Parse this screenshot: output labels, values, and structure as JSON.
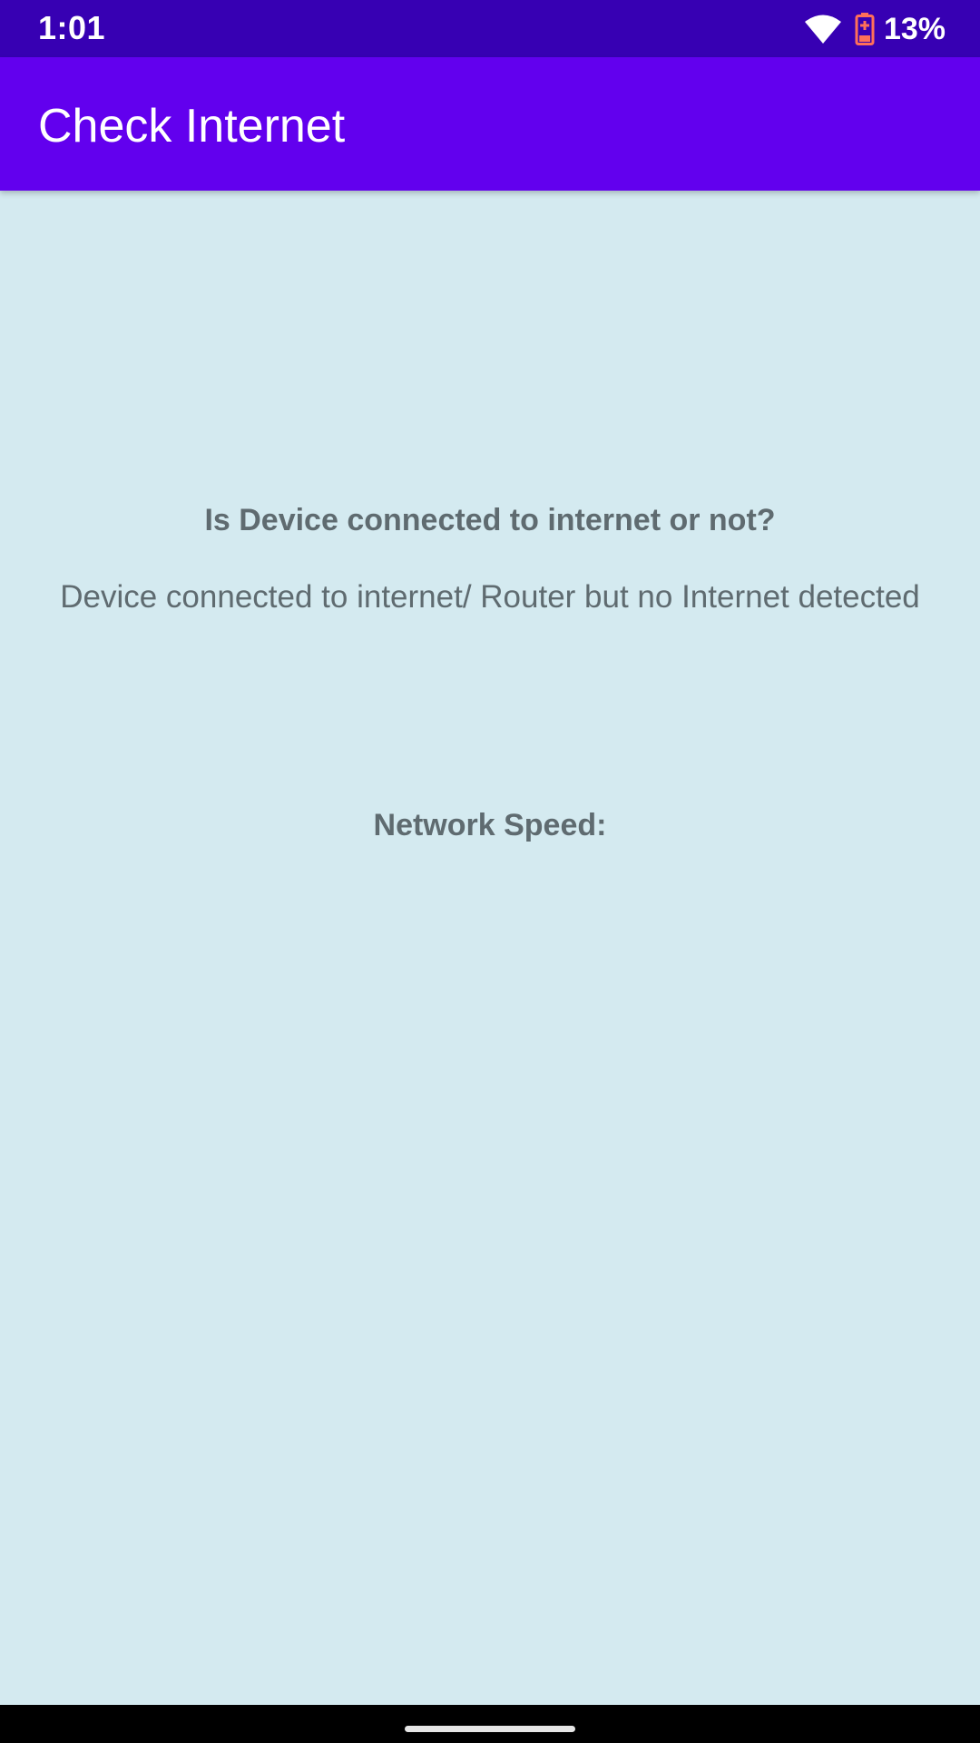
{
  "status_bar": {
    "time": "1:01",
    "battery_percent": "13%",
    "wifi_icon": "wifi-icon",
    "battery_icon": "battery-charging-icon",
    "battery_color": "#ff6f59",
    "background_color": "#3700b3"
  },
  "app_bar": {
    "title": "Check Internet",
    "background_color": "#6200ee"
  },
  "main": {
    "question": "Is Device connected to internet or not?",
    "status_message": "Device connected to internet/ Router but no Internet detected",
    "speed_label": "Network Speed:",
    "background_color": "#d4eaf0"
  },
  "nav_bar": {
    "home_handle_icon": "home-handle-icon"
  }
}
